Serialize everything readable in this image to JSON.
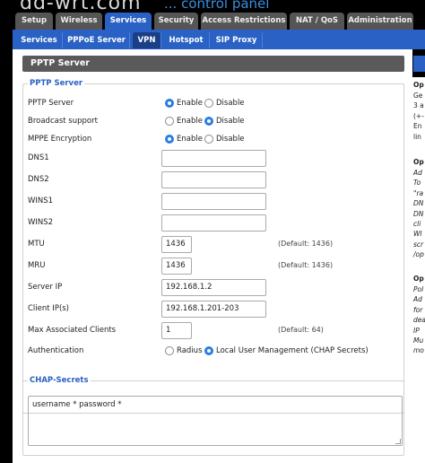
{
  "header": {
    "logo": "dd-wrt.com",
    "logo_sub": "... control panel"
  },
  "main_tabs": [
    {
      "label": "Setup"
    },
    {
      "label": "Wireless"
    },
    {
      "label": "Services"
    },
    {
      "label": "Security"
    },
    {
      "label": "Access Restrictions"
    },
    {
      "label": "NAT / QoS"
    },
    {
      "label": "Administration"
    }
  ],
  "sub_tabs": [
    {
      "label": "Services"
    },
    {
      "label": "PPPoE Server"
    },
    {
      "label": "VPN"
    },
    {
      "label": "Hotspot"
    },
    {
      "label": "SIP Proxy"
    }
  ],
  "page_title": "PPTP Server",
  "pptp": {
    "legend": "PPTP Server",
    "rows": [
      {
        "label": "PPTP Server",
        "opt1": "Enable",
        "opt2": "Disable",
        "selected": "Enable"
      },
      {
        "label": "Broadcast support",
        "opt1": "Enable",
        "opt2": "Disable",
        "selected": "Disable"
      },
      {
        "label": "MPPE Encryption",
        "opt1": "Enable",
        "opt2": "Disable",
        "selected": "Enable"
      }
    ],
    "dns1": {
      "label": "DNS1",
      "value": ""
    },
    "dns2": {
      "label": "DNS2",
      "value": ""
    },
    "wins1": {
      "label": "WINS1",
      "value": ""
    },
    "wins2": {
      "label": "WINS2",
      "value": ""
    },
    "mtu": {
      "label": "MTU",
      "value": "1436",
      "note": "(Default: 1436)"
    },
    "mru": {
      "label": "MRU",
      "value": "1436",
      "note": "(Default: 1436)"
    },
    "server_ip": {
      "label": "Server IP",
      "value": "192.168.1.2"
    },
    "client_ips": {
      "label": "Client IP(s)",
      "value": "192.168.1.201-203"
    },
    "max_clients": {
      "label": "Max Associated Clients",
      "value": "1",
      "note": "(Default: 64)"
    },
    "auth": {
      "label": "Authentication",
      "opt1": "Radius",
      "opt2": "Local User Management (CHAP Secrets)",
      "selected": "Local User Management (CHAP Secrets)"
    }
  },
  "chap": {
    "legend": "CHAP-Secrets",
    "value": "username * password *"
  },
  "side_help": {
    "title1": "Op",
    "text1": "Ge\n3 a\n(+-\nEn\nlin",
    "title2": "Op",
    "text2": "Ad\nTo\n\"ra\nDN\nDN\ncli\nWI\nscr\n/op",
    "title3": "Op",
    "text3": "Pol\nAd\nfor\ndea\nIP\nMu\nmo"
  },
  "colors": {
    "accent": "#2a61c4",
    "radio_checked": "#2a7de1",
    "title_bar": "#5a5a5a"
  }
}
